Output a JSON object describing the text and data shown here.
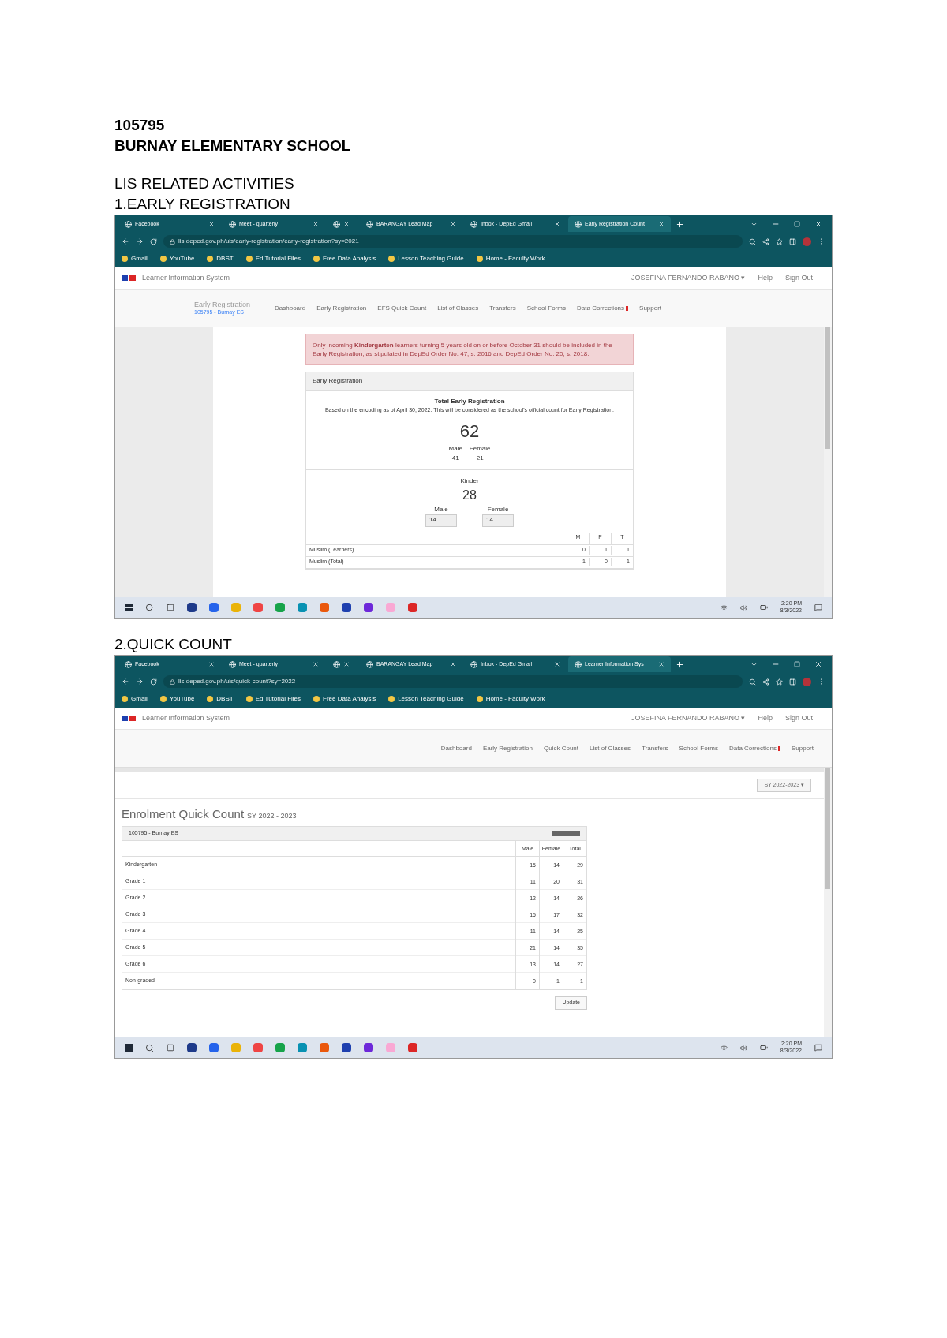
{
  "document": {
    "school_id": "105795",
    "school_name": "BURNAY ELEMENTARY SCHOOL",
    "section_title": "LIS RELATED ACTIVITIES"
  },
  "screenshots": [
    {
      "kind": "early_registration",
      "heading": "1.EARLY REGISTRATION",
      "browser": {
        "tabs": [
          {
            "label": "Facebook",
            "selected": false
          },
          {
            "label": "Meet - quarterly",
            "selected": false
          },
          {
            "selected": false
          },
          {
            "label": "BARANGAY Lead Map",
            "selected": false
          },
          {
            "label": "Inbox - DepEd Gmail",
            "selected": false
          },
          {
            "label": "Early Registration Count",
            "selected": true
          }
        ],
        "address": "lis.deped.gov.ph/uis/early-registration/early-registration?sy=2021",
        "bookmarks": [
          "Gmail",
          "YouTube",
          "DBST",
          "Ed Tutorial Files",
          "Free Data Analysis",
          "Lesson Teaching Guide",
          "Home - Faculty Work"
        ]
      },
      "app": {
        "title": "Learner Information System",
        "user": "JOSEFINA FERNANDO RABANO ▾",
        "links": [
          "Help",
          "Sign Out"
        ],
        "brand": "Early Registration",
        "brand_sub": "105795 - Burnay ES",
        "nav": [
          {
            "label": "Dashboard",
            "badge": false
          },
          {
            "label": "Early Registration",
            "badge": false
          },
          {
            "label": "EFS Quick Count",
            "badge": false
          },
          {
            "label": "List of Classes",
            "badge": false
          },
          {
            "label": "Transfers",
            "badge": false
          },
          {
            "label": "School Forms",
            "badge": false
          },
          {
            "label": "Data Corrections",
            "badge": true
          },
          {
            "label": "Support",
            "badge": false
          }
        ]
      },
      "content": {
        "alert": "Only incoming **Kindergarten** learners turning 5 years old on or before October 31 should be included in the Early Registration, as stipulated in DepEd Order No. 47, s. 2016 and DepEd Order No. 20, s. 2018.",
        "panel_title": "Early Registration",
        "total_title": "Total Early Registration",
        "total_note": "Based on the encoding as of April 30, 2022. This will be considered as the school's official count for Early Registration.",
        "total": "62",
        "total_split": [
          {
            "label": "Male",
            "value": "41"
          },
          {
            "label": "Female",
            "value": "21"
          }
        ],
        "grade_title": "Kinder",
        "grade_total": "28",
        "grade_split": [
          {
            "label": "Male",
            "value": "14"
          },
          {
            "label": "Female",
            "value": "14"
          }
        ],
        "columns": [
          "M",
          "F",
          "T"
        ],
        "rows": [
          {
            "label": "Muslim (Learners)",
            "cells": [
              "0",
              "1",
              "1"
            ]
          },
          {
            "label": "Muslim (Total)",
            "cells": [
              "1",
              "0",
              "1"
            ]
          }
        ]
      },
      "taskbar": {
        "time": "2:20 PM",
        "date": "8/3/2022"
      }
    },
    {
      "kind": "quick_count",
      "heading": "2.QUICK COUNT",
      "browser": {
        "tabs": [
          {
            "label": "Facebook",
            "selected": false
          },
          {
            "label": "Meet - quarterly",
            "selected": false
          },
          {
            "selected": false
          },
          {
            "label": "BARANGAY Lead Map",
            "selected": false
          },
          {
            "label": "Inbox - DepEd Gmail",
            "selected": false
          },
          {
            "label": "Learner Information Sys",
            "selected": true
          }
        ],
        "address": "lis.deped.gov.ph/uis/quick-count?sy=2022",
        "bookmarks": [
          "Gmail",
          "YouTube",
          "DBST",
          "Ed Tutorial Files",
          "Free Data Analysis",
          "Lesson Teaching Guide",
          "Home - Faculty Work"
        ]
      },
      "app": {
        "title": "Learner Information System",
        "user": "JOSEFINA FERNANDO RABANO ▾",
        "links": [
          "Help",
          "Sign Out"
        ],
        "nav": [
          {
            "label": "Dashboard",
            "badge": false
          },
          {
            "label": "Early Registration",
            "badge": false
          },
          {
            "label": "Quick Count",
            "badge": false
          },
          {
            "label": "List of Classes",
            "badge": false
          },
          {
            "label": "Transfers",
            "badge": false
          },
          {
            "label": "School Forms",
            "badge": false
          },
          {
            "label": "Data Corrections",
            "badge": true
          },
          {
            "label": "Support",
            "badge": false
          }
        ]
      },
      "content": {
        "year_select": "SY 2022-2023 ▾",
        "title": "Enrolment Quick Count",
        "title_sub": "SY 2022 - 2023",
        "panel_title": "105795 - Burnay ES",
        "columns": [
          "Male",
          "Female",
          "Total"
        ],
        "rows": [
          {
            "label": "Kindergarten",
            "cells": [
              "15",
              "14",
              "29"
            ]
          },
          {
            "label": "Grade 1",
            "cells": [
              "11",
              "20",
              "31"
            ]
          },
          {
            "label": "Grade 2",
            "cells": [
              "12",
              "14",
              "26"
            ]
          },
          {
            "label": "Grade 3",
            "cells": [
              "15",
              "17",
              "32"
            ]
          },
          {
            "label": "Grade 4",
            "cells": [
              "11",
              "14",
              "25"
            ]
          },
          {
            "label": "Grade 5",
            "cells": [
              "21",
              "14",
              "35"
            ]
          },
          {
            "label": "Grade 6",
            "cells": [
              "13",
              "14",
              "27"
            ]
          },
          {
            "label": "Non-graded",
            "cells": [
              "0",
              "1",
              "1"
            ]
          }
        ],
        "button": "Update"
      },
      "taskbar": {
        "time": "2:20 PM",
        "date": "8/3/2022"
      }
    }
  ]
}
